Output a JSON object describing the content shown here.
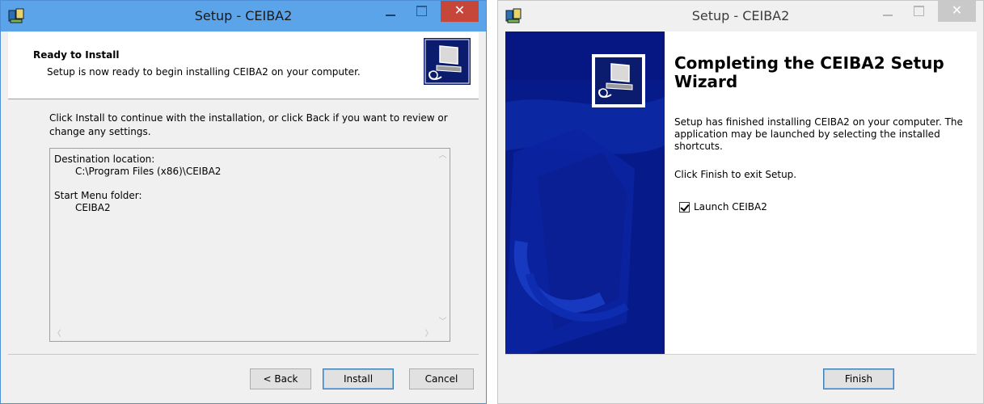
{
  "window_left": {
    "title": "Setup - CEIBA2",
    "header": {
      "title": "Ready to Install",
      "subtitle": "Setup is now ready to begin installing CEIBA2 on your computer."
    },
    "body_text": "Click Install to continue with the installation, or click Back if you want to review or change any settings.",
    "memo": {
      "destination_label": "Destination location:",
      "destination_value": "C:\\Program Files (x86)\\CEIBA2",
      "start_menu_label": "Start Menu folder:",
      "start_menu_value": "CEIBA2"
    },
    "buttons": {
      "back": "< Back",
      "install": "Install",
      "cancel": "Cancel"
    },
    "close_glyph": "✕"
  },
  "window_right": {
    "title": "Setup - CEIBA2",
    "heading": "Completing the CEIBA2 Setup Wizard",
    "text": "Setup has finished installing CEIBA2 on your computer. The application may be launched by selecting the installed shortcuts.",
    "finish_text": "Click Finish to exit Setup.",
    "launch_checkbox": {
      "label": "Launch CEIBA2",
      "checked": true
    },
    "buttons": {
      "finish": "Finish"
    },
    "close_glyph": "✕"
  },
  "icons": {
    "app_icon": "installer-icon",
    "header_image": "computer-setup-icon",
    "side_panel": "blue-wizard-artwork"
  },
  "colors": {
    "active_titlebar": "#5ba4ea",
    "close_active": "#c7463a",
    "wizard_panel": "#071a8a"
  }
}
